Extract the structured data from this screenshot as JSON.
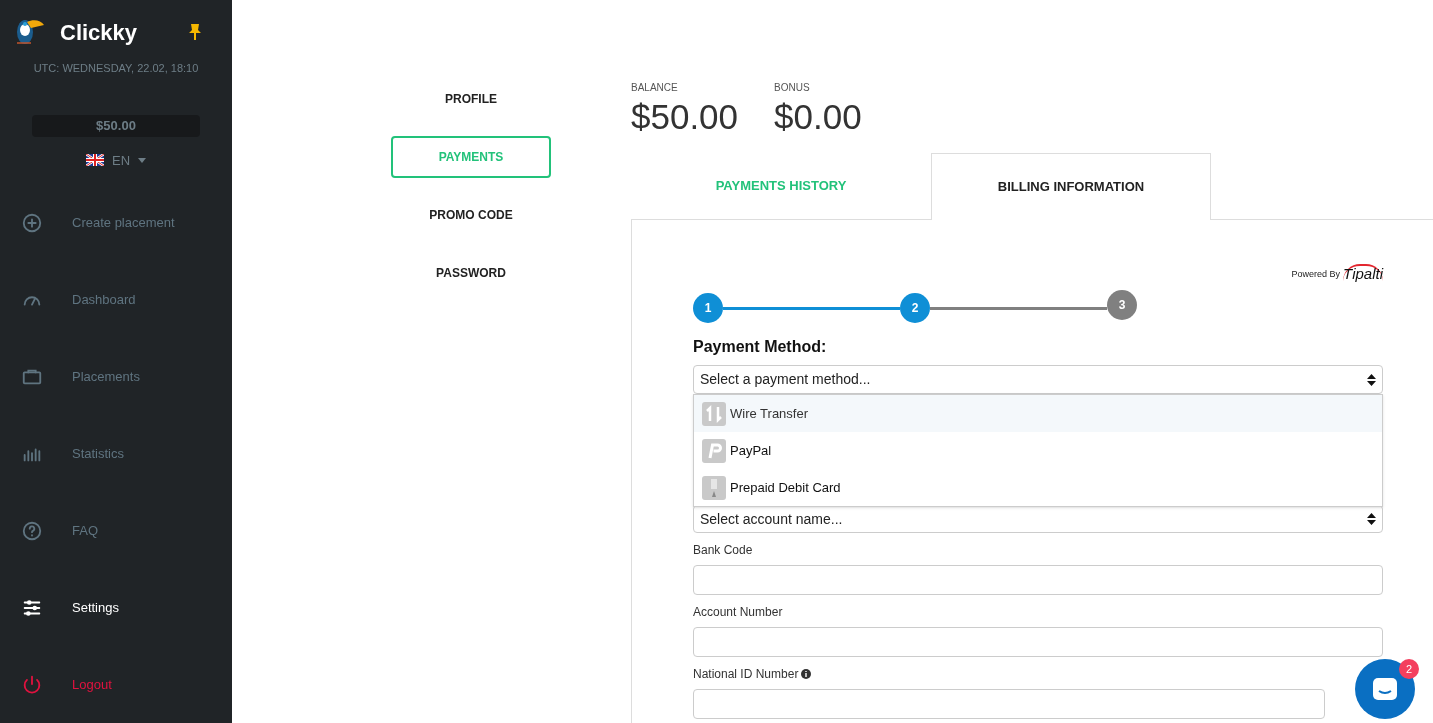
{
  "sidebar": {
    "brand": "Clickky",
    "clock": "UTC: WEDNESDAY, 22.02, 18:10",
    "balance": "$50.00",
    "language": "EN",
    "items": [
      {
        "label": "Create placement",
        "kind": "create",
        "selected": false
      },
      {
        "label": "Dashboard",
        "kind": "dashboard",
        "selected": false
      },
      {
        "label": "Placements",
        "kind": "placements",
        "selected": false
      },
      {
        "label": "Statistics",
        "kind": "statistics",
        "selected": false
      },
      {
        "label": "FAQ",
        "kind": "faq",
        "selected": false
      },
      {
        "label": "Settings",
        "kind": "settings",
        "selected": true
      },
      {
        "label": "Logout",
        "kind": "logout",
        "selected": false
      }
    ]
  },
  "settings_nav": [
    {
      "label": "PROFILE",
      "selected": false
    },
    {
      "label": "PAYMENTS",
      "selected": true
    },
    {
      "label": "PROMO CODE",
      "selected": false
    },
    {
      "label": "PASSWORD",
      "selected": false
    }
  ],
  "balances": [
    {
      "label": "BALANCE",
      "value": "$50.00"
    },
    {
      "label": "BONUS",
      "value": "$0.00"
    }
  ],
  "tabs": [
    {
      "label": "PAYMENTS HISTORY",
      "selected": false
    },
    {
      "label": "BILLING INFORMATION",
      "selected": true
    }
  ],
  "billing": {
    "powered_by": "Powered By",
    "provider": "Tipalti",
    "steps": [
      {
        "label": "1",
        "done": true
      },
      {
        "label": "2",
        "done": true
      },
      {
        "label": "3",
        "done": false
      }
    ],
    "payment_method_label": "Payment Method:",
    "payment_select": "Select a payment method...",
    "options": [
      {
        "label": "Wire Transfer",
        "kind": "transfer",
        "selected": true
      },
      {
        "label": "PayPal",
        "kind": "paypal",
        "selected": false
      },
      {
        "label": "Prepaid Debit Card",
        "kind": "card",
        "selected": false
      }
    ],
    "account_select": "Select account name...",
    "fields": [
      {
        "label": "Bank Code",
        "info": false
      },
      {
        "label": "Account Number",
        "info": false
      },
      {
        "label": "National ID Number",
        "info": true
      }
    ]
  },
  "chat": {
    "badge": "2"
  }
}
